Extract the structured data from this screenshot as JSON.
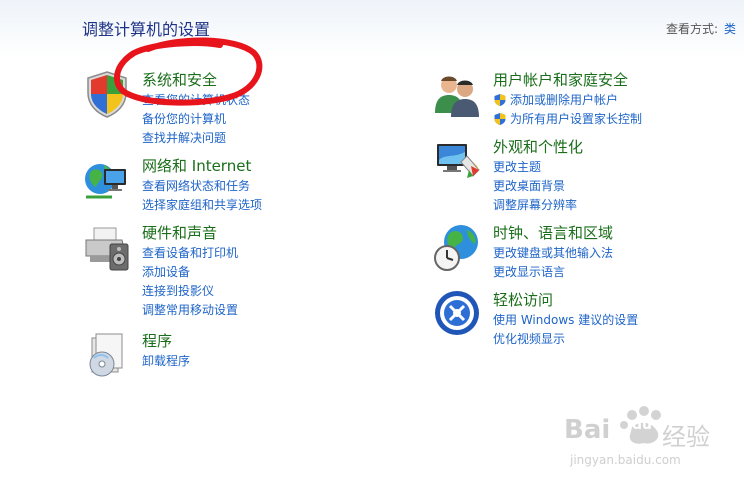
{
  "header": {
    "title": "调整计算机的设置",
    "view_label": "查看方式:",
    "view_value": "类"
  },
  "categories": [
    {
      "title": "系统和安全",
      "icon": "shield-icon",
      "links": [
        {
          "text": "查看您的计算机状态"
        },
        {
          "text": "备份您的计算机"
        },
        {
          "text": "查找并解决问题"
        }
      ]
    },
    {
      "title": "网络和 Internet",
      "icon": "network-icon",
      "links": [
        {
          "text": "查看网络状态和任务"
        },
        {
          "text": "选择家庭组和共享选项"
        }
      ]
    },
    {
      "title": "硬件和声音",
      "icon": "printer-icon",
      "links": [
        {
          "text": "查看设备和打印机"
        },
        {
          "text": "添加设备"
        },
        {
          "text": "连接到投影仪"
        },
        {
          "text": "调整常用移动设置"
        }
      ]
    },
    {
      "title": "程序",
      "icon": "programs-icon",
      "links": [
        {
          "text": "卸载程序"
        }
      ]
    },
    {
      "title": "用户帐户和家庭安全",
      "icon": "users-icon",
      "links": [
        {
          "text": "添加或删除用户帐户",
          "shield": true
        },
        {
          "text": "为所有用户设置家长控制",
          "shield": true
        }
      ]
    },
    {
      "title": "外观和个性化",
      "icon": "monitor-paint-icon",
      "links": [
        {
          "text": "更改主题"
        },
        {
          "text": "更改桌面背景"
        },
        {
          "text": "调整屏幕分辨率"
        }
      ]
    },
    {
      "title": "时钟、语言和区域",
      "icon": "globe-clock-icon",
      "links": [
        {
          "text": "更改键盘或其他输入法"
        },
        {
          "text": "更改显示语言"
        }
      ]
    },
    {
      "title": "轻松访问",
      "icon": "ease-of-access-icon",
      "links": [
        {
          "text": "使用 Windows 建议的设置"
        },
        {
          "text": "优化视频显示"
        }
      ]
    }
  ],
  "watermark": {
    "text": "Bai",
    "paw": "du",
    "brand": "经验",
    "url": "jingyan.baidu.com"
  },
  "colors": {
    "category_title": "#1a6e1a",
    "link": "#1e64c8",
    "header_title": "#1e3287",
    "annotation": "#e8141c"
  }
}
